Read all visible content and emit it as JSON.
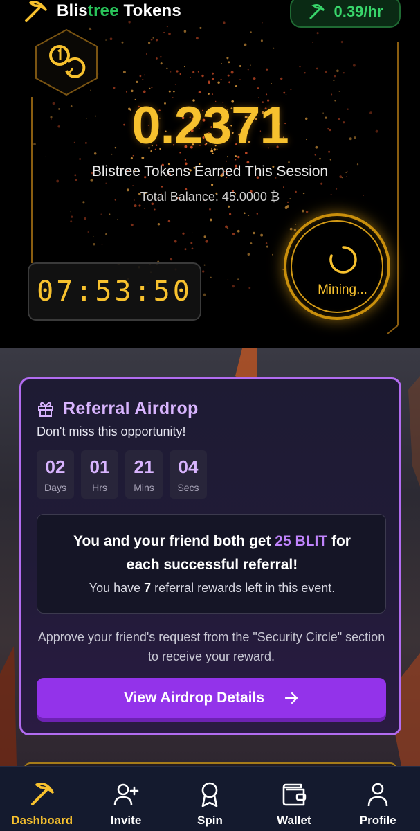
{
  "header": {
    "title_main": "Blis",
    "title_accent": "tree",
    "title_rest": " Tokens",
    "rate": "0.39/hr"
  },
  "mining": {
    "session_value": "0.2371",
    "session_label": "Blistree Tokens Earned This Session",
    "total_balance": "Total Balance: 45.0000 ₿",
    "timer": "07:53:50",
    "status_label": "Mining..."
  },
  "airdrop": {
    "title": "Referral Airdrop",
    "subtitle": "Don't miss this opportunity!",
    "countdown": [
      {
        "value": "02",
        "unit": "Days"
      },
      {
        "value": "01",
        "unit": "Hrs"
      },
      {
        "value": "21",
        "unit": "Mins"
      },
      {
        "value": "04",
        "unit": "Secs"
      }
    ],
    "reward_prefix": "You and your friend both get ",
    "reward_amount": "25 BLIT",
    "reward_suffix": " for",
    "reward_line2": "each successful referral!",
    "remaining_prefix": "You have ",
    "remaining_count": "7",
    "remaining_suffix": " referral rewards left in this event.",
    "approve_text": "Approve your friend's request from the \"Security Circle\" section to receive your reward.",
    "button_label": "View Airdrop Details"
  },
  "nav": {
    "items": [
      {
        "label": "Dashboard",
        "icon": "pickaxe-icon",
        "active": true
      },
      {
        "label": "Invite",
        "icon": "add-user-icon"
      },
      {
        "label": "Spin",
        "icon": "award-icon"
      },
      {
        "label": "Wallet",
        "icon": "wallet-icon"
      },
      {
        "label": "Profile",
        "icon": "user-icon"
      }
    ]
  },
  "colors": {
    "gold": "#f7c12e",
    "green": "#38d46a",
    "purple": "#9333ea",
    "lavender": "#d8b4fe",
    "nav_bg": "#141a2e"
  }
}
